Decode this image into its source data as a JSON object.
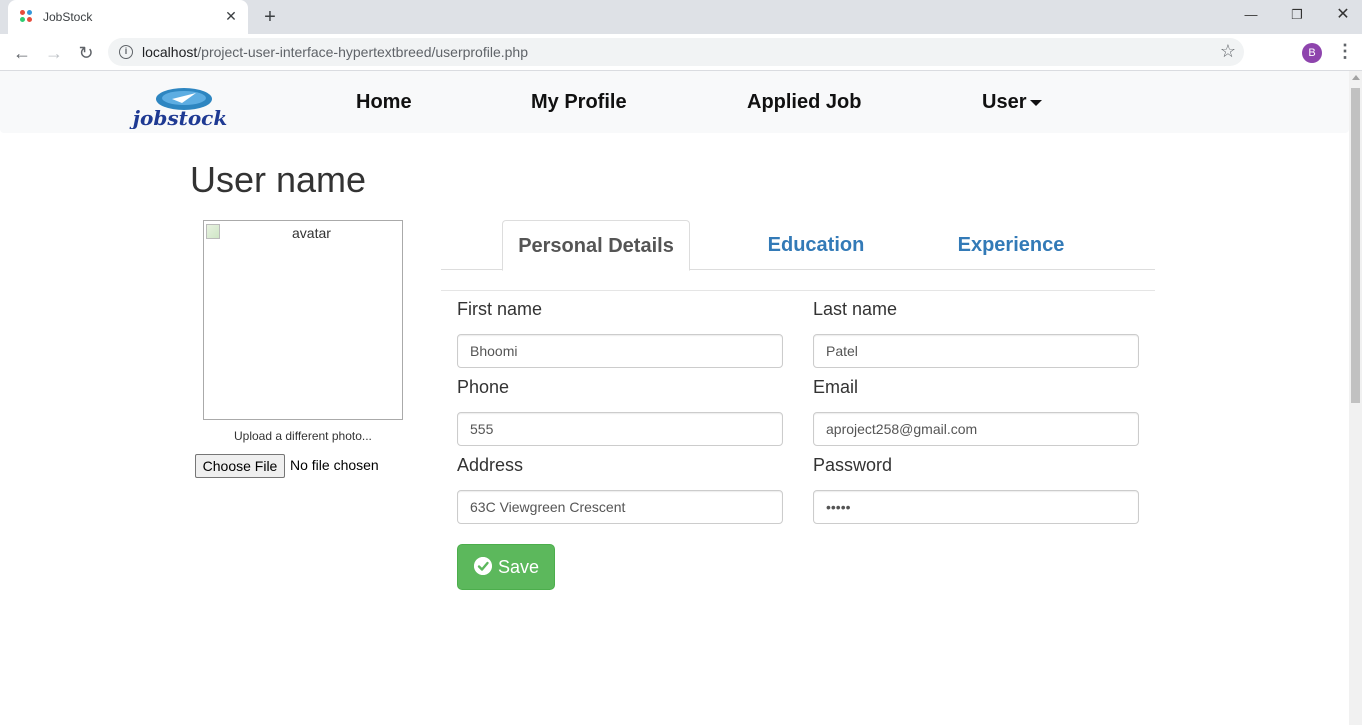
{
  "browser": {
    "tab_title": "JobStock",
    "url_host": "localhost",
    "url_path": "/project-user-interface-hypertextbreed/userprofile.php",
    "profile_initial": "B"
  },
  "nav": {
    "logo_text": "jobstock",
    "links": [
      "Home",
      "My Profile",
      "Applied Job",
      "User"
    ]
  },
  "page": {
    "title": "User name",
    "avatar_alt": "avatar",
    "upload_caption": "Upload a different photo...",
    "file_button": "Choose File",
    "file_status": "No file chosen"
  },
  "tabs": [
    "Personal Details",
    "Education",
    "Experience"
  ],
  "form": {
    "first_name_label": "First name",
    "first_name_value": "Bhoomi",
    "last_name_label": "Last name",
    "last_name_value": "Patel",
    "phone_label": "Phone",
    "phone_value": "555",
    "email_label": "Email",
    "email_value": "aproject258@gmail.com",
    "address_label": "Address",
    "address_value": "63C Viewgreen Crescent",
    "password_label": "Password",
    "password_value": "•••••",
    "save_label": "Save"
  },
  "colors": {
    "accent_link": "#337ab7",
    "save_green": "#5cb85c",
    "profile_purple": "#8e44ad"
  }
}
